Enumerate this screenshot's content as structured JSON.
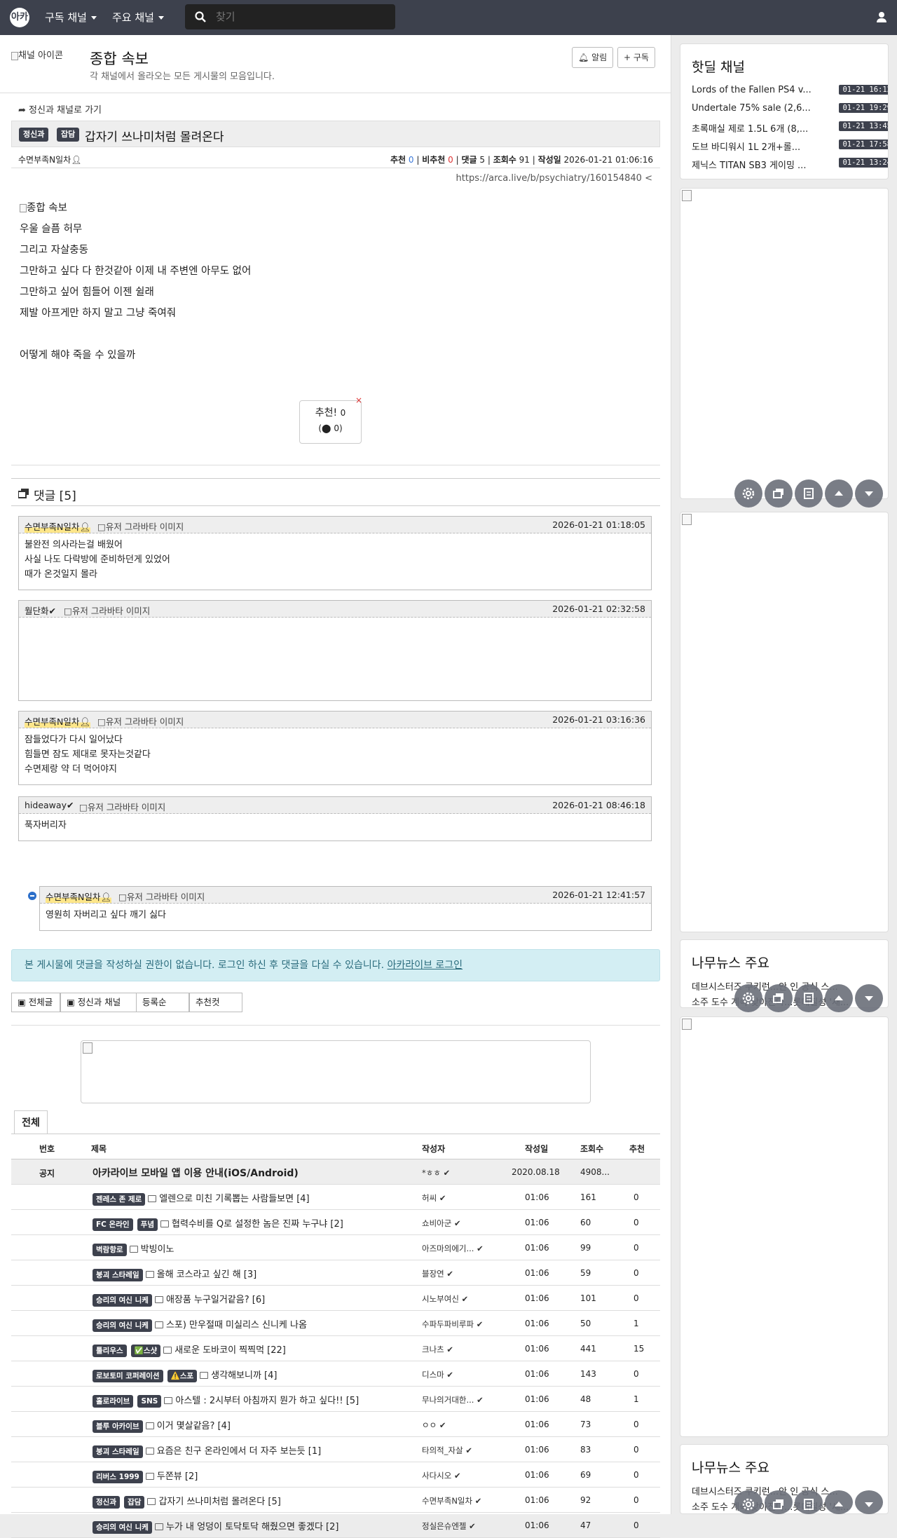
{
  "topbar": {
    "logo": "아카",
    "nav_subscribed": "구독 채널",
    "nav_main": "주요 채널",
    "search_placeholder": "찾기"
  },
  "channel_header": {
    "icon_alt": "채널 아이콘",
    "title": "종합 속보",
    "description": "각 채널에서 올라오는 모든 게시물의 모음입니다.",
    "alarm_label": "알림",
    "subscribe_label": "구독"
  },
  "post": {
    "back_link": "정신과 채널로 가기",
    "category_badge": "정신과",
    "tag_badge": "잡담",
    "title": "갑자기 쓰나미처럼 몰려온다",
    "author": "수면부족N일차",
    "upvotes_label": "추천",
    "upvotes": "0",
    "downvotes_label": "비추천",
    "downvotes": "0",
    "comments_label": "댓글",
    "comments": "5",
    "views_label": "조회수",
    "views": "91",
    "date_label": "작성일",
    "date": "2026-01-21 01:06:16",
    "url": "https://arca.live/b/psychiatry/160154840",
    "image_alt": "종합 속보",
    "lines": [
      "우울 슬픔 허무",
      "그리고 자살충동",
      "그만하고 싶다 다 한것같아 이제 내 주변엔 아무도 없어",
      "그만하고 싶어 힘들어 이젠 쉴래",
      "제발 아프게만 하지 말고 그냥 죽여줘",
      "",
      "어떻게 해야 죽을 수 있을까"
    ],
    "vote_label": "추천!",
    "vote_count": "0",
    "vote_sub": "(",
    "vote_sub_count": "0)"
  },
  "comments_section": {
    "title": "댓글 [5]",
    "avatar_alt": "유저 그라바타 이미지",
    "items": [
      {
        "author": "수면부족N일차",
        "date": "2026-01-21 01:18:05",
        "text": [
          "불완전 의사라는걸 배웠어",
          "사실 나도 다락방에 준비하던게 있었어",
          "때가 온것일지 몰라"
        ]
      },
      {
        "author": "월단화",
        "date": "2026-01-21 02:32:58",
        "text": []
      },
      {
        "author": "수면부족N일차",
        "date": "2026-01-21 03:16:36",
        "text": [
          "잠들었다가 다시 일어났다",
          "힘들면 잠도 제대로 못자는것같다",
          "수면제랑 약 더 먹어야지"
        ]
      },
      {
        "author": "hideaway",
        "date": "2026-01-21 08:46:18",
        "text": [
          "푹자버리자"
        ]
      },
      {
        "author": "수면부족N일차",
        "date": "2026-01-21 12:41:57",
        "text": [
          "영원히 자버리고 싶다 깨기 싫다"
        ]
      }
    ]
  },
  "login_notice": {
    "text": "본 게시물에 댓글을 작성하실 권한이 없습니다. 로그인 하신 후 댓글을 다실 수 있습니다.",
    "link": "아카라이브 로그인"
  },
  "list_controls": {
    "all_posts": "전체글",
    "channel": "정신과 채널",
    "sort": "등록순",
    "best": "추천컷"
  },
  "list": {
    "tab": "전체",
    "headers": {
      "no": "번호",
      "title": "제목",
      "author": "작성자",
      "date": "작성일",
      "views": "조회수",
      "recommend": "추천"
    },
    "notice": {
      "no": "공지",
      "title": "아카라이브 모바일 앱 이용 안내(iOS/Android)",
      "author": "*ㅎㅎ",
      "date": "2020.08.18",
      "views": "4908...",
      "recommend": ""
    },
    "rows": [
      {
        "badges": [
          "젠레스 존 제로"
        ],
        "title": "엘렌으로 미친 기록뽑는 사람들보면 [4]",
        "author": "허씨",
        "date": "01:06",
        "views": "161",
        "recommend": "0"
      },
      {
        "badges": [
          "FC 온라인",
          "푸념"
        ],
        "title": "협력수비를 Q로 설정한 놈은 진짜 누구냐 [2]",
        "author": "쇼비아군",
        "date": "01:06",
        "views": "60",
        "recommend": "0"
      },
      {
        "badges": [
          "벽람항로"
        ],
        "title": "박빙이노",
        "author": "아즈마의에기...",
        "date": "01:06",
        "views": "99",
        "recommend": "0"
      },
      {
        "badges": [
          "붕괴 스타레일"
        ],
        "title": "올해 코스라고 싶긴 해 [3]",
        "author": "블장연",
        "date": "01:06",
        "views": "59",
        "recommend": "0"
      },
      {
        "badges": [
          "승리의 여신 니케"
        ],
        "title": "애장품 누구일거같음? [6]",
        "author": "시노부여신",
        "date": "01:06",
        "views": "101",
        "recommend": "0"
      },
      {
        "badges": [
          "승리의 여신 니케"
        ],
        "title": "스포) 만우절때 미실리스 신니케 나옴",
        "author": "수파두파비루파",
        "date": "01:06",
        "views": "50",
        "recommend": "1"
      },
      {
        "badges": [
          "툴리우스",
          "✅스샷"
        ],
        "title": "새로운 도바코이 찍찍먹 [22]",
        "author": "크나츠",
        "date": "01:06",
        "views": "441",
        "recommend": "15"
      },
      {
        "badges": [
          "로보토미 코퍼레이션",
          "⚠️스포"
        ],
        "title": "생각해보니까 [4]",
        "author": "디스마",
        "date": "01:06",
        "views": "143",
        "recommend": "0"
      },
      {
        "badges": [
          "홀로라이브",
          "SNS"
        ],
        "title": "아스텔 : 2시부터 아침까지 뭔가 하고 싶다!! [5]",
        "author": "무나의거대한...",
        "date": "01:06",
        "views": "48",
        "recommend": "1"
      },
      {
        "badges": [
          "블루 아카이브"
        ],
        "title": "이거 몇살같음? [4]",
        "author": "ㅇㅇ",
        "date": "01:06",
        "views": "73",
        "recommend": "0"
      },
      {
        "badges": [
          "붕괴 스타레일"
        ],
        "title": "요즘은 친구 온라인에서 더 자주 보는듯 [1]",
        "author": "타의적_자살",
        "date": "01:06",
        "views": "83",
        "recommend": "0"
      },
      {
        "badges": [
          "리버스 1999"
        ],
        "title": "두쫀뷰 [2]",
        "author": "사다시오",
        "date": "01:06",
        "views": "69",
        "recommend": "0"
      },
      {
        "badges": [
          "정신과",
          "잡담"
        ],
        "title": "갑자기 쓰나미처럼 몰려온다 [5]",
        "author": "수면부족N일차",
        "date": "01:06",
        "views": "92",
        "recommend": "0"
      },
      {
        "badges": [
          "승리의 여신 니케"
        ],
        "title": "누가 내 엉덩이 토닥토닥 해줬으면 좋겠다 [2]",
        "author": "정실은슈엔젤",
        "date": "01:06",
        "views": "47",
        "recommend": "0"
      }
    ]
  },
  "sidebar": {
    "hotdeal_title": "핫딜 채널",
    "deals": [
      {
        "name": "Lords of the Fallen PS4 v...",
        "date": "01-21 16:12"
      },
      {
        "name": "Undertale 75% sale (2,6...",
        "date": "01-21 19:29"
      },
      {
        "name": "초록매실 제로 1.5L 6개 (8,...",
        "date": "01-21 13:45"
      },
      {
        "name": "도브 바디워시 1L 2개+롤...",
        "date": "01-21 17:58"
      },
      {
        "name": "제닉스 TITAN SB3 게이밍 ...",
        "date": "01-21 13:24"
      }
    ],
    "news_title": "나무뉴스 주요",
    "news": [
      "데브시스터즈 쿠키런...안 인 공식 스...",
      "소주 도수 계속 낮아진다...롯데칠성 '새..."
    ]
  },
  "colors": {
    "topbar": "#3d414d",
    "badge": "#3d414d",
    "notice_bg": "#d3eef3",
    "upvote": "#3b78d8",
    "downvote": "#dd3333"
  }
}
